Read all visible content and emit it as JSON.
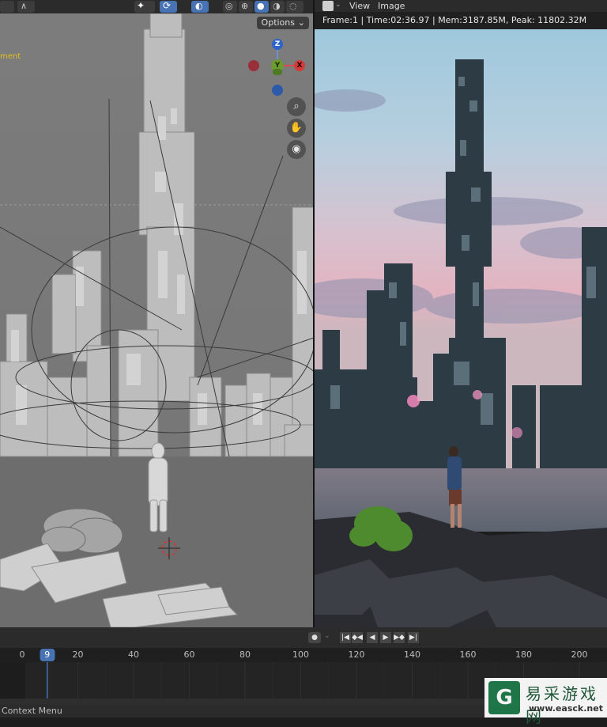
{
  "left_editor": {
    "options_label": "Options",
    "overlay_text": "ment",
    "gizmo": {
      "z": "Z",
      "x": "X",
      "y": "Y"
    },
    "nav_icons": [
      "zoom-icon",
      "hand-pan-icon",
      "camera-icon"
    ]
  },
  "right_editor": {
    "menu": {
      "view": "View",
      "image": "Image"
    },
    "render_info": "Frame:1 | Time:02:36.97 | Mem:3187.85M, Peak: 11802.32M"
  },
  "timeline": {
    "current_frame": "9",
    "ticks": [
      {
        "label": "0",
        "frame": 0
      },
      {
        "label": "20",
        "frame": 20
      },
      {
        "label": "40",
        "frame": 40
      },
      {
        "label": "60",
        "frame": 60
      },
      {
        "label": "80",
        "frame": 80
      },
      {
        "label": "100",
        "frame": 100
      },
      {
        "label": "120",
        "frame": 120
      },
      {
        "label": "140",
        "frame": 140
      },
      {
        "label": "160",
        "frame": 160
      },
      {
        "label": "180",
        "frame": 180
      },
      {
        "label": "200",
        "frame": 200
      }
    ],
    "controls": [
      "jump-start-icon",
      "prev-keyframe-icon",
      "play-reverse-icon",
      "play-icon",
      "next-keyframe-icon",
      "jump-end-icon"
    ]
  },
  "status_bar": {
    "text": "Context Menu"
  },
  "watermark": {
    "chinese": "易采游戏网",
    "url": "www.easck.net"
  },
  "colors": {
    "accent": "#4772b3",
    "header": "#2b2b2b",
    "viewport_gray": "#7a7a7a"
  }
}
